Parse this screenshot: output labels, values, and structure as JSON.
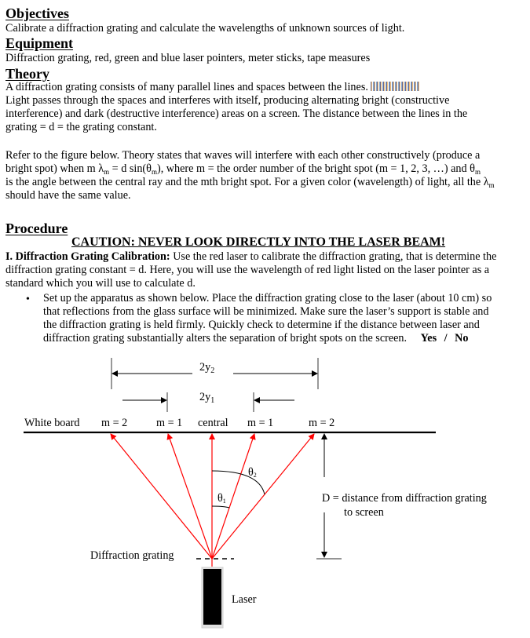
{
  "objectives": {
    "heading": "Objectives",
    "text": "Calibrate a diffraction grating and calculate the wavelengths of unknown sources of light."
  },
  "equipment": {
    "heading": "Equipment",
    "text": "Diffraction grating, red, green and blue laser pointers, meter sticks, tape measures"
  },
  "theory": {
    "heading": "Theory",
    "line1": "A diffraction grating consists of many parallel lines and spaces between the lines.",
    "line2": "Light passes through the spaces and interferes with itself, producing alternating bright (constructive",
    "line3": "interference) and dark (destructive interference) areas on a screen.  The distance between the lines in the",
    "line4": "grating = d = the grating constant.",
    "para2_line1": "Refer to the figure below.  Theory states that waves will interfere with each other constructively (produce a",
    "para2_line2a": "bright spot) when   m λ",
    "para2_line2_sub1": "m",
    "para2_line2b": " = d sin(θ",
    "para2_line2_sub2": "m",
    "para2_line2c": "), where m = the order number of the bright spot (m = 1, 2, 3, …) and θ",
    "para2_line2_sub3": "m",
    "para2_line3a": "is the angle between the central ray and the mth bright spot.  For a given color (wavelength) of light, all the λ",
    "para2_line3_sub": "m",
    "para2_line4": "should have the same value."
  },
  "procedure": {
    "heading": "Procedure",
    "caution": "CAUTION:  NEVER LOOK DIRECTLY INTO THE LASER BEAM!",
    "section1_title": "I. Diffraction Grating Calibration:",
    "section1_line1": " Use the red laser to calibrate the diffraction grating, that is determine the",
    "section1_line2": "diffraction grating constant = d.  Here, you will use the wavelength of red light listed on the laser pointer as a",
    "section1_line3": "standard which you will use to calculate d.",
    "bullet_line1": "Set up the apparatus as shown below.  Place the diffraction grating close to the laser (about 10 cm) so",
    "bullet_line2": "that reflections from the glass surface will be minimized.  Make sure the laser’s support is stable and",
    "bullet_line3": "the diffraction grating is held firmly.  Quickly check to determine if the distance between laser and",
    "bullet_line4": "diffraction grating substantially alters the separation of bright spots on the screen.",
    "answer_yes": "Yes",
    "answer_sep": "/",
    "answer_no": "No"
  },
  "diagram": {
    "label_2y2": "2y",
    "label_2y2_sub": "2",
    "label_2y1": "2y",
    "label_2y1_sub": "1",
    "screen_label": "White board",
    "spot_labels": [
      "m = 2",
      "m = 1",
      "central",
      "m = 1",
      "m = 2"
    ],
    "theta1": "θ",
    "theta1_sub": "1",
    "theta2": "θ",
    "theta2_sub": "2",
    "d_label_line1": "D = distance from diffraction grating",
    "d_label_line2": "to screen",
    "grating_label": "Diffraction grating",
    "laser_label": "Laser",
    "ray_color": "#ff0000"
  }
}
